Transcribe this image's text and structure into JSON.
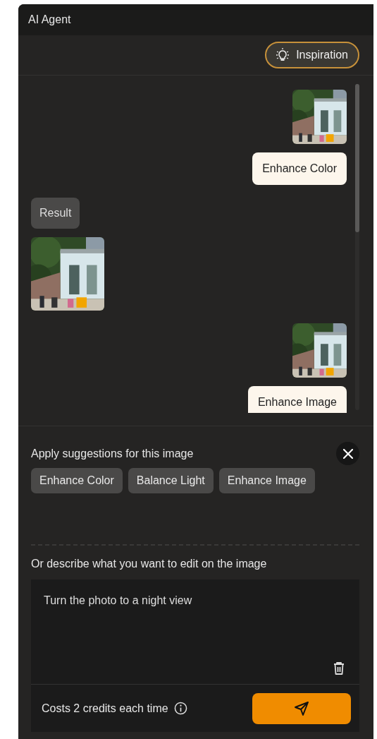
{
  "panel": {
    "title": "AI Agent"
  },
  "toolbar": {
    "inspiration_button": "Inspiration"
  },
  "messages": [
    {
      "kind": "user_image"
    },
    {
      "kind": "user_text",
      "text": "Enhance Color"
    },
    {
      "kind": "agent_text",
      "text": "Result"
    },
    {
      "kind": "agent_image"
    },
    {
      "kind": "user_image"
    },
    {
      "kind": "user_text",
      "text": "Enhance Image"
    }
  ],
  "suggestions": {
    "title": "Apply suggestions for this image",
    "chips": [
      "Enhance Color",
      "Balance Light",
      "Enhance Image"
    ]
  },
  "prompt": {
    "label": "Or describe what you want to edit on the image",
    "value": "Turn the photo to a night view",
    "cost": "Costs 2 credits each time"
  }
}
